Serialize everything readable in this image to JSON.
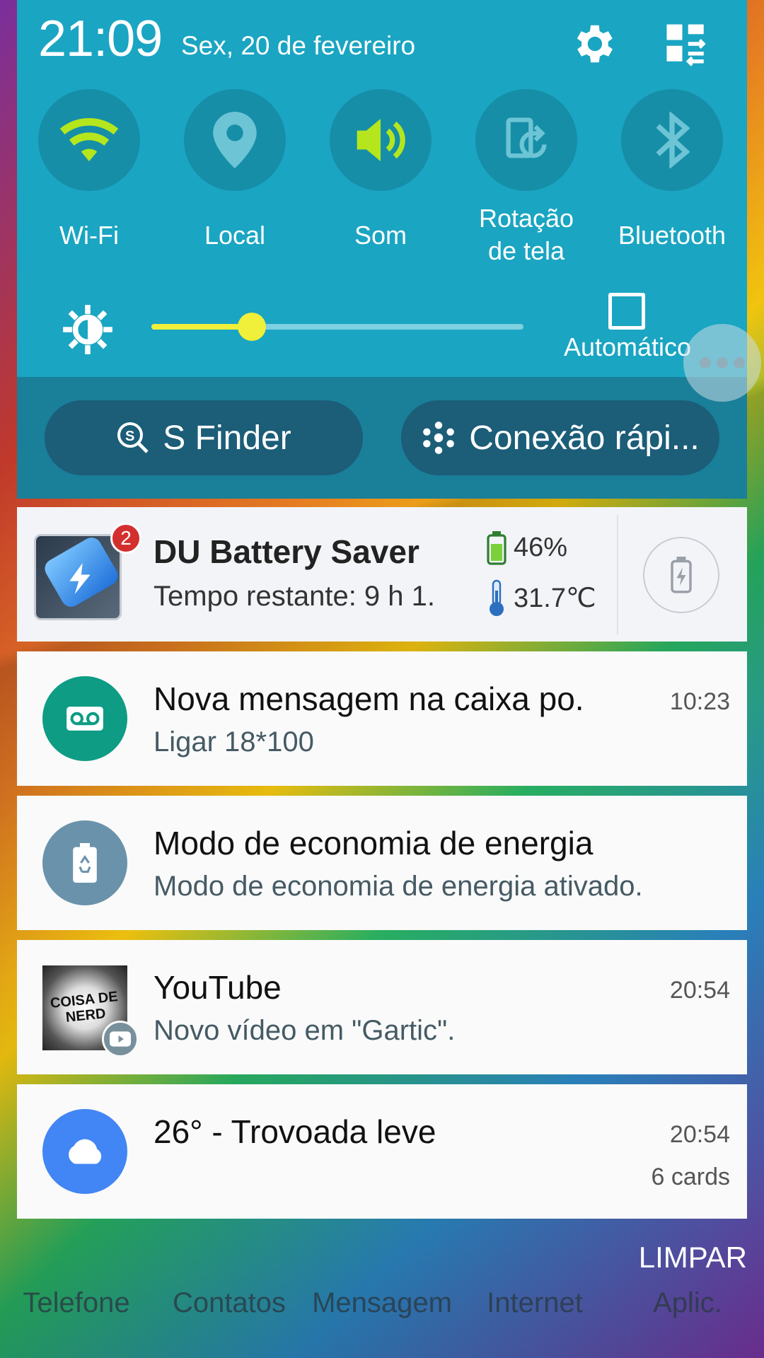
{
  "status": {
    "time": "21:09",
    "date": "Sex, 20 de fevereiro"
  },
  "quick_settings": {
    "toggles": [
      {
        "label": "Wi-Fi",
        "icon": "wifi-icon",
        "active": true
      },
      {
        "label": "Local",
        "icon": "location-icon",
        "active": false
      },
      {
        "label": "Som",
        "icon": "sound-icon",
        "active": true
      },
      {
        "label": "Rotação\nde tela",
        "label_line1": "Rotação",
        "label_line2": "de tela",
        "icon": "rotation-icon",
        "active": false
      },
      {
        "label": "Bluetooth",
        "icon": "bluetooth-icon",
        "active": false
      }
    ],
    "brightness_level": 0.27,
    "auto_label": "Automático",
    "s_finder_label": "S Finder",
    "quick_connect_label": "Conexão rápi..."
  },
  "notifications": {
    "du_battery": {
      "title": "DU Battery Saver",
      "text": "Tempo restante: 9 h 1.",
      "badge": "2",
      "battery": "46%",
      "temperature": "31.7℃"
    },
    "voicemail": {
      "title": "Nova mensagem na caixa po.",
      "text": "Ligar 18*100",
      "time": "10:23"
    },
    "power_saving": {
      "title": "Modo de economia de energia",
      "text": "Modo de economia de energia ativado."
    },
    "youtube": {
      "title": "YouTube",
      "text": "Novo vídeo em \"Gartic\".",
      "time": "20:54",
      "thumb_text": "COISA DE NERD"
    },
    "weather": {
      "title": "26° - Trovoada leve",
      "time": "20:54",
      "cards": "6 cards"
    }
  },
  "clear_label": "LIMPAR",
  "dock": {
    "labels": [
      "Telefone",
      "Contatos",
      "Mensagem",
      "Internet",
      "Aplic."
    ]
  },
  "colors": {
    "shade": "#1aa5c2",
    "shade_lower": "#1a7f99",
    "active_toggle": "#b5e61d",
    "slider": "#f0ef3a"
  }
}
